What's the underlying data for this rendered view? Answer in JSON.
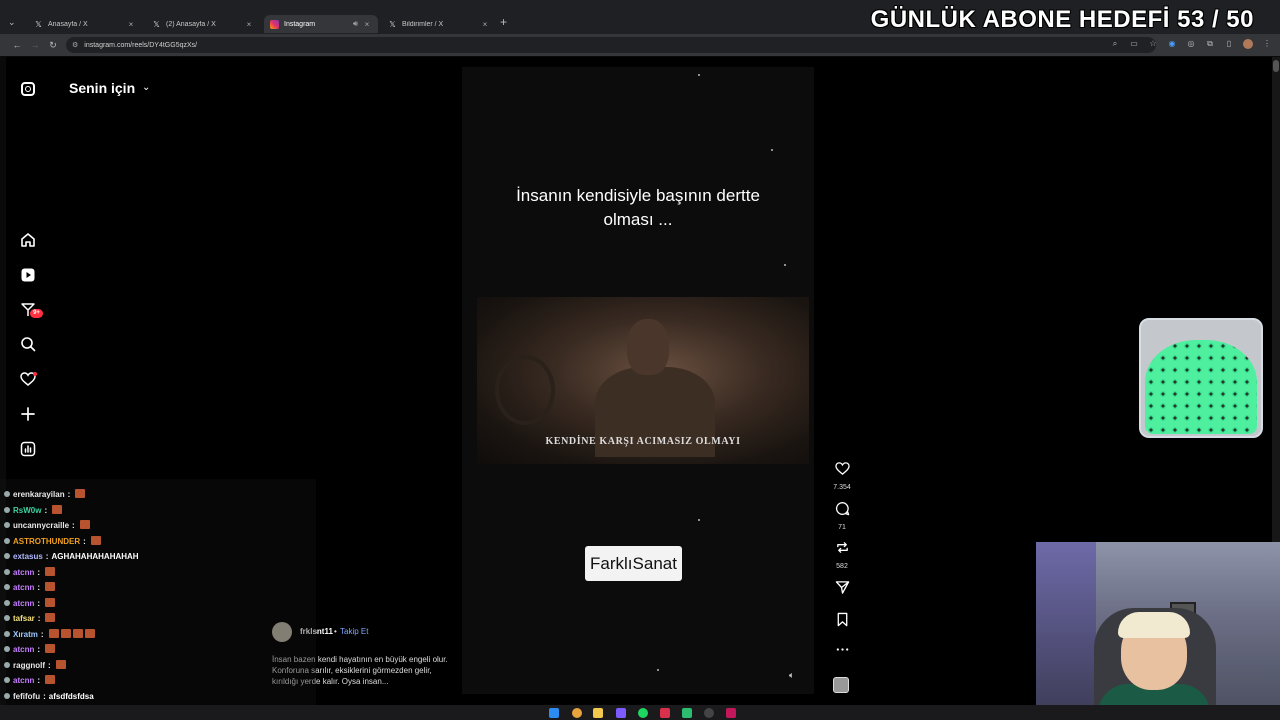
{
  "browser": {
    "tabs": [
      {
        "label": "Anasayfa / X",
        "icon": "x-logo-icon",
        "active": false
      },
      {
        "label": "(2) Anasayfa / X",
        "icon": "x-logo-icon",
        "active": false
      },
      {
        "label": "Instagram",
        "icon": "instagram-icon",
        "active": true,
        "audio": true
      },
      {
        "label": "Bildirimler / X",
        "icon": "x-logo-icon",
        "active": false
      }
    ],
    "tab_close": "×",
    "new_tab": "+",
    "url": "instagram.com/reels/DY4tGG5qzXs/"
  },
  "overlay": {
    "goal": "GÜNLÜK ABONE HEDEFİ 53 / 50"
  },
  "instagram": {
    "feed_title": "Senin için",
    "nav_badge": "9+",
    "reel": {
      "caption_line1": "İnsanın kendisiyle başının dertte",
      "caption_line2": "olması ...",
      "subtitle": "KENDİNE KARŞI ACIMASIZ OLMAYI",
      "watermark": "FarklıSanat"
    },
    "actions": {
      "likes": "7.354",
      "comments": "71",
      "reposts": "582"
    },
    "post": {
      "username": "frklsnt11",
      "separator": "•",
      "follow": "Takip Et",
      "description": "İnsan bazen kendi hayatının en büyük engeli olur. Konforuna sarılır, eksiklerini görmezden gelir, kırıldığı yerde kalır. Oysa insan..."
    }
  },
  "chat": {
    "messages": [
      {
        "user": "erenkarayilan",
        "color": "#e8e8e8",
        "text": "",
        "emotes": 1
      },
      {
        "user": "RsW0w",
        "color": "#3fd2a0",
        "text": "",
        "emotes": 1
      },
      {
        "user": "uncannycraille",
        "color": "#e8e8e8",
        "text": "",
        "emotes": 1
      },
      {
        "user": "ASTROTHUNDER",
        "color": "#f0a020",
        "text": "",
        "emotes": 1
      },
      {
        "user": "extasus",
        "color": "#b0b8ff",
        "text": "AGHAHAHAHAHAHAH",
        "emotes": 0
      },
      {
        "user": "atcnn",
        "color": "#c77dff",
        "text": "",
        "emotes": 1
      },
      {
        "user": "atcnn",
        "color": "#c77dff",
        "text": "",
        "emotes": 1
      },
      {
        "user": "atcnn",
        "color": "#c77dff",
        "text": "",
        "emotes": 1
      },
      {
        "user": "tafsar",
        "color": "#f6e27a",
        "text": "",
        "emotes": 1
      },
      {
        "user": "Xıratm",
        "color": "#9ec7ff",
        "text": "",
        "emotes": 4
      },
      {
        "user": "atcnn",
        "color": "#c77dff",
        "text": "",
        "emotes": 1
      },
      {
        "user": "raggnolf",
        "color": "#e8e8e8",
        "text": "",
        "emotes": 1
      },
      {
        "user": "atcnn",
        "color": "#c77dff",
        "text": "",
        "emotes": 1
      },
      {
        "user": "fefifofu",
        "color": "#e8e8e8",
        "text": "afsdfdsfdsa",
        "emotes": 0
      }
    ],
    "separator": ":"
  }
}
